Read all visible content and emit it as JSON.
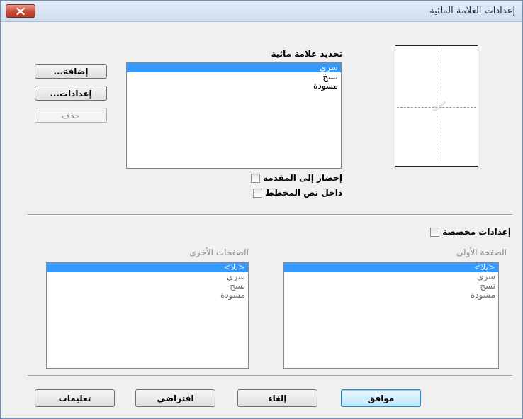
{
  "window": {
    "title": "إعدادات العلامة المائية"
  },
  "preview": {
    "watermark_text": "سري"
  },
  "watermark_select": {
    "label": "تحديد علامة مائية",
    "items": [
      {
        "label": "سري",
        "selected": true
      },
      {
        "label": "نسخ",
        "selected": false
      },
      {
        "label": "مسودة",
        "selected": false
      }
    ]
  },
  "side_buttons": {
    "add": "إضافة...",
    "settings": "إعدادات...",
    "delete": "حذف"
  },
  "options": {
    "bring_to_front": "إحضار إلى المقدمة",
    "in_outline_text": "داخل نص المخطط"
  },
  "custom": {
    "label": "إعدادات مخصصة",
    "first_page": {
      "label": "الصفحة الأولى",
      "items": [
        {
          "label": "<بلا>",
          "selected": true
        },
        {
          "label": "سري",
          "selected": false
        },
        {
          "label": "نسخ",
          "selected": false
        },
        {
          "label": "مسودة",
          "selected": false
        }
      ]
    },
    "other_pages": {
      "label": "الصفحات الأخرى",
      "items": [
        {
          "label": "<بلا>",
          "selected": true
        },
        {
          "label": "سري",
          "selected": false
        },
        {
          "label": "نسخ",
          "selected": false
        },
        {
          "label": "مسودة",
          "selected": false
        }
      ]
    }
  },
  "footer": {
    "ok": "موافق",
    "cancel": "إلغاء",
    "default": "افتراضي",
    "help": "تعليمات"
  }
}
